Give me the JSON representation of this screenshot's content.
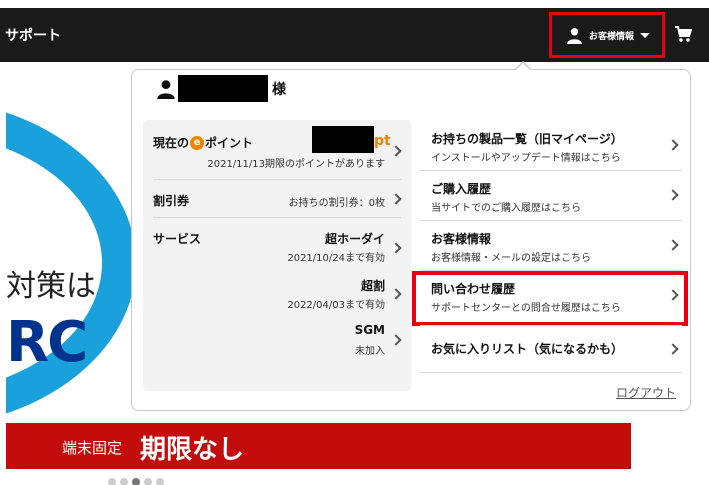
{
  "header": {
    "left_label": "サポート",
    "account_label": "お客様情報"
  },
  "banner": {
    "text": "対策は",
    "logo": "RC",
    "red_small": "端末固定",
    "red_big": "期限なし"
  },
  "panel": {
    "honorific": "様",
    "points": {
      "label_prefix": "現在の",
      "icon_letter": "e",
      "label_suffix": "ポイント",
      "unit": "pt",
      "note": "2021/11/13期限のポイントがあります"
    },
    "coupon": {
      "label": "割引券",
      "value": "お持ちの割引券：0枚"
    },
    "services": {
      "label": "サービス",
      "items": [
        {
          "name": "超ホーダイ",
          "detail": "2021/10/24まで有効"
        },
        {
          "name": "超割",
          "detail": "2022/04/03まで有効"
        },
        {
          "name": "SGM",
          "detail": "未加入"
        }
      ]
    },
    "menu": [
      {
        "title": "お持ちの製品一覧（旧マイページ）",
        "sub": "インストールやアップデート情報はこちら"
      },
      {
        "title": "ご購入履歴",
        "sub": "当サイトでのご購入履歴はこちら"
      },
      {
        "title": "お客様情報",
        "sub": "お客様情報・メールの設定はこちら"
      },
      {
        "title": "問い合わせ履歴",
        "sub": "サポートセンターとの問合せ履歴はこちら"
      },
      {
        "title": "お気に入りリスト（気になるかも）",
        "sub": ""
      }
    ],
    "logout": "ログアウト"
  },
  "colors": {
    "accent": "#e60012",
    "points": "#f08300",
    "topbar": "#1a1a1a"
  }
}
